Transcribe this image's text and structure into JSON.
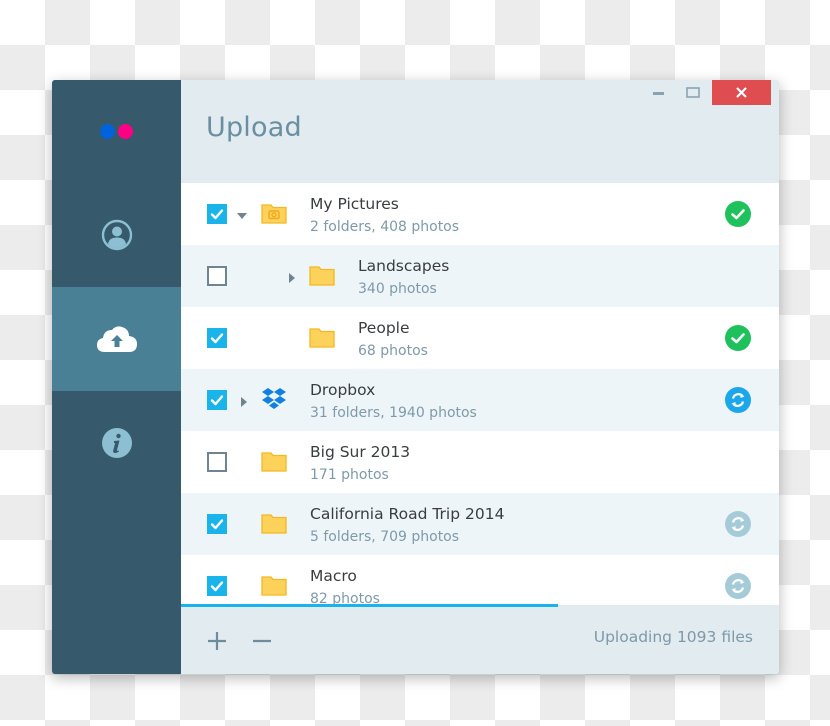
{
  "app": {
    "title": "Upload",
    "logo": {
      "dot_left_color": "#0063dc",
      "dot_right_color": "#ff0084"
    }
  },
  "window_controls": {
    "minimize": "minimize-icon",
    "maximize": "maximize-icon",
    "close": "close-icon",
    "close_color": "#e04d50"
  },
  "sidebar": {
    "items": [
      {
        "id": "account",
        "icon": "user-circle-icon",
        "active": false
      },
      {
        "id": "upload",
        "icon": "cloud-upload-icon",
        "active": true
      },
      {
        "id": "info",
        "icon": "info-icon",
        "active": false
      }
    ]
  },
  "colors": {
    "accent": "#1bb4ea",
    "sidebar_bg": "#36596b",
    "sidebar_active": "#4a8096",
    "folder": "#fdd25a",
    "status_done": "#1ec15c",
    "status_syncing": "#1ba7ea",
    "status_queued": "#a6cbd8"
  },
  "items": [
    {
      "name": "My Pictures",
      "detail": "2 folders, 408 photos",
      "checked": true,
      "expander": "expanded",
      "icon": "camera-folder-icon",
      "level": 0,
      "status": "done"
    },
    {
      "name": "Landscapes",
      "detail": "340 photos",
      "checked": false,
      "expander": "collapsed",
      "icon": "folder-icon",
      "level": 1,
      "status": "none"
    },
    {
      "name": "People",
      "detail": "68 photos",
      "checked": true,
      "expander": "none",
      "icon": "folder-icon",
      "level": 1,
      "status": "done"
    },
    {
      "name": "Dropbox",
      "detail": "31 folders, 1940 photos",
      "checked": true,
      "expander": "collapsed",
      "icon": "dropbox-icon",
      "level": 0,
      "status": "syncing"
    },
    {
      "name": "Big Sur 2013",
      "detail": "171 photos",
      "checked": false,
      "expander": "none",
      "icon": "folder-icon",
      "level": 0,
      "status": "none"
    },
    {
      "name": "California Road Trip 2014",
      "detail": "5 folders, 709 photos",
      "checked": true,
      "expander": "none",
      "icon": "folder-icon",
      "level": 0,
      "status": "queued"
    },
    {
      "name": "Macro",
      "detail": "82 photos",
      "checked": true,
      "expander": "none",
      "icon": "folder-icon",
      "level": 0,
      "status": "queued"
    }
  ],
  "progress": {
    "fraction": 0.63
  },
  "footer": {
    "add": "plus-icon",
    "remove": "minus-icon",
    "status_text": "Uploading 1093 files"
  }
}
